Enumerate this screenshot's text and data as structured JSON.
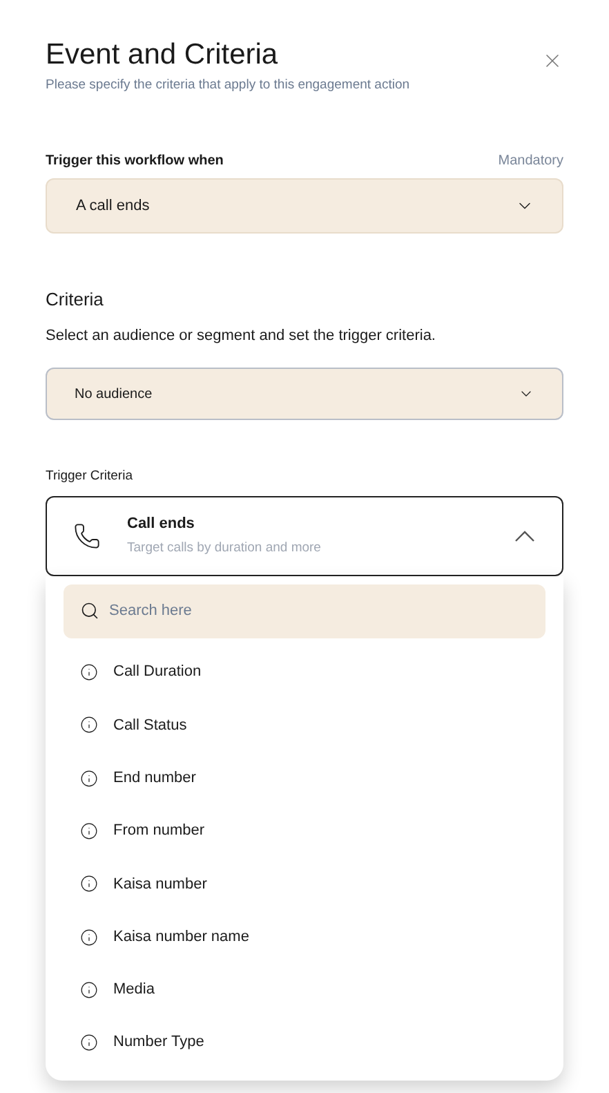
{
  "header": {
    "title": "Event and Criteria",
    "subtitle": "Please specify the criteria that apply to this engagement action"
  },
  "trigger": {
    "label": "Trigger this workflow when",
    "badge": "Mandatory",
    "value": "A call ends"
  },
  "criteria": {
    "heading": "Criteria",
    "description": "Select an audience or segment and set the trigger criteria.",
    "audience": "No audience"
  },
  "trigger_criteria": {
    "label": "Trigger Criteria",
    "title": "Call ends",
    "subtitle": "Target calls by duration and more",
    "expanded": true,
    "search": {
      "placeholder": "Search here"
    },
    "options": [
      {
        "label": "Call Duration"
      },
      {
        "label": "Call Status"
      },
      {
        "label": "End number"
      },
      {
        "label": "From number"
      },
      {
        "label": "Kaisa number"
      },
      {
        "label": "Kaisa number name"
      },
      {
        "label": "Media"
      },
      {
        "label": "Number Type"
      }
    ]
  }
}
